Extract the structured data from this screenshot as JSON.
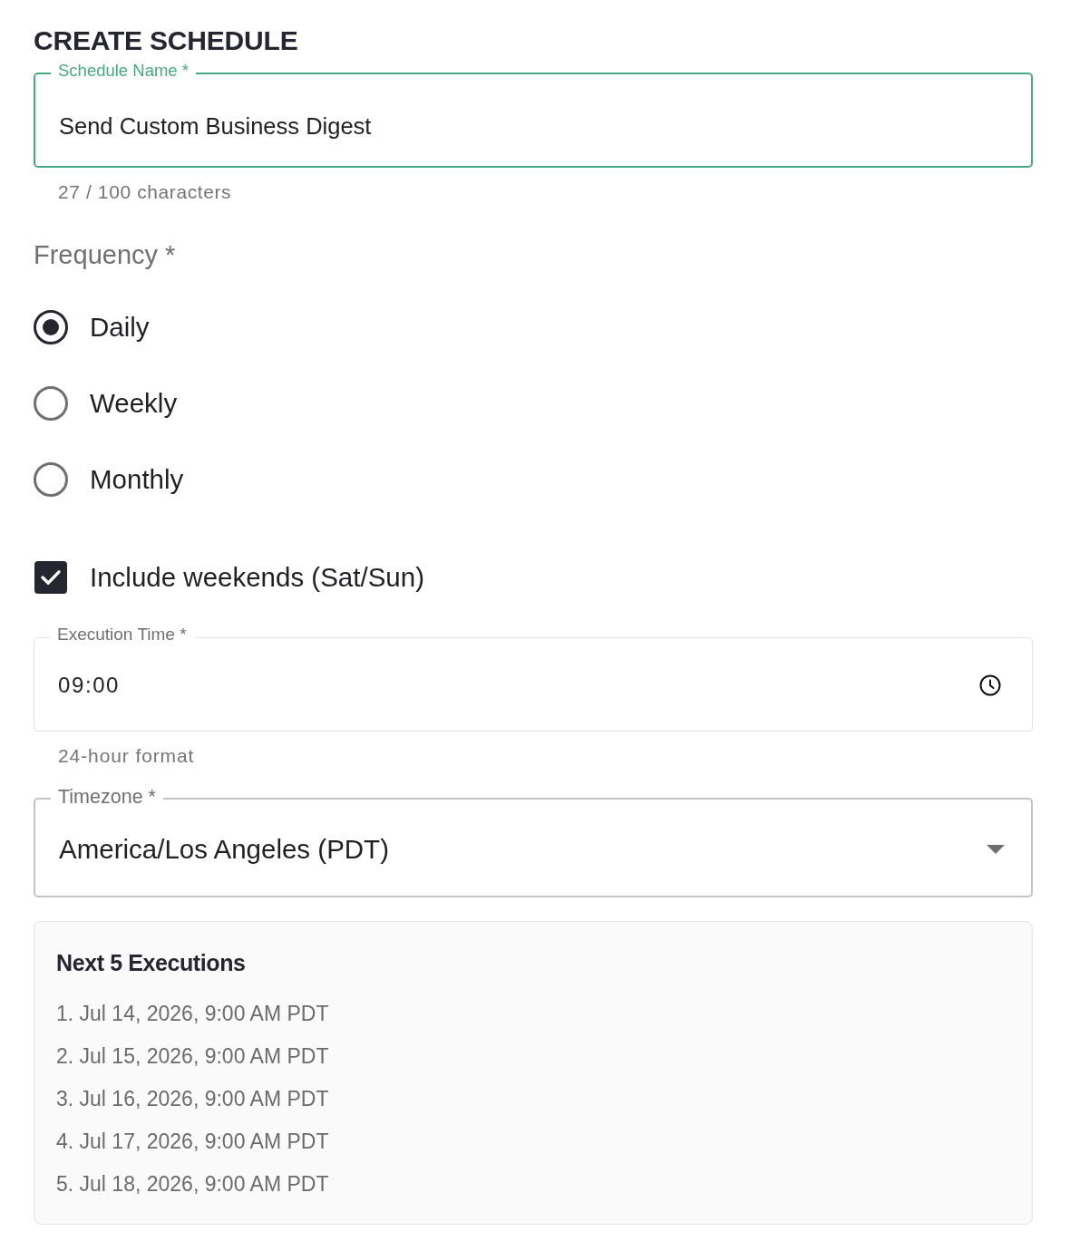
{
  "title": "CREATE SCHEDULE",
  "schedule_name": {
    "label": "Schedule Name *",
    "value": "Send Custom Business Digest",
    "focused": true,
    "helper": "27 / 100 characters"
  },
  "frequency": {
    "label": "Frequency *",
    "options": [
      {
        "label": "Daily",
        "selected": true
      },
      {
        "label": "Weekly",
        "selected": false
      },
      {
        "label": "Monthly",
        "selected": false
      }
    ]
  },
  "include_weekends": {
    "label": "Include weekends (Sat/Sun)",
    "checked": true
  },
  "execution_time": {
    "label": "Execution Time *",
    "value": "09:00",
    "focused": false,
    "helper": "24-hour format"
  },
  "timezone": {
    "label": "Timezone *",
    "value": "America/Los Angeles (PDT)",
    "focused": false
  },
  "next_executions": {
    "title": "Next 5 Executions",
    "items": [
      "1. Jul 14, 2026, 9:00 AM PDT",
      "2. Jul 15, 2026, 9:00 AM PDT",
      "3. Jul 16, 2026, 9:00 AM PDT",
      "4. Jul 17, 2026, 9:00 AM PDT",
      "5. Jul 18, 2026, 9:00 AM PDT"
    ]
  }
}
